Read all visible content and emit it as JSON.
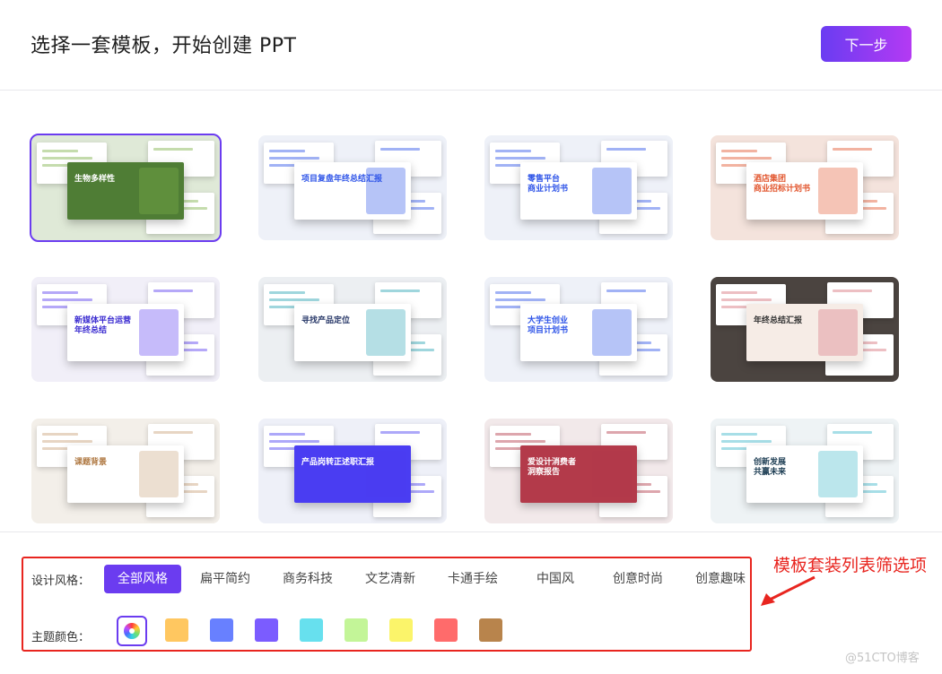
{
  "header": {
    "title": "选择一套模板，开始创建 PPT",
    "next_label": "下一步"
  },
  "templates": [
    {
      "title": "生物多样性",
      "theme": "green",
      "selected": true
    },
    {
      "title": "项目复盘年终总结汇报",
      "theme": "blue"
    },
    {
      "title": "零售平台\n商业计划书",
      "theme": "blue"
    },
    {
      "title": "酒店集团\n商业招标计划书",
      "theme": "orange"
    },
    {
      "title": "新媒体平台运营\n年终总结",
      "theme": "purple"
    },
    {
      "title": "寻找产品定位",
      "theme": "teal"
    },
    {
      "title": "大学生创业\n项目计划书",
      "theme": "blue"
    },
    {
      "title": "年终总结汇报",
      "theme": "pink"
    },
    {
      "title": "课题背景",
      "theme": "beige"
    },
    {
      "title": "产品岗转正述职汇报",
      "theme": "indigo"
    },
    {
      "title": "爱设计消费者\n洞察报告",
      "theme": "red"
    },
    {
      "title": "创新发展\n共赢未来",
      "theme": "cyan"
    }
  ],
  "filters": {
    "style_label": "设计风格：",
    "styles": [
      "全部风格",
      "扁平简约",
      "商务科技",
      "文艺清新",
      "卡通手绘",
      "中国风",
      "创意时尚",
      "创意趣味"
    ],
    "active_style": "全部风格",
    "color_label": "主题颜色：",
    "colors": [
      "#ffc760",
      "#6880ff",
      "#7b5cff",
      "#67e0ee",
      "#c3f598",
      "#fbf46a",
      "#ff6b6b",
      "#b8844c"
    ]
  },
  "annotation": "模板套装列表筛选项",
  "watermark": "@51CTO博客"
}
